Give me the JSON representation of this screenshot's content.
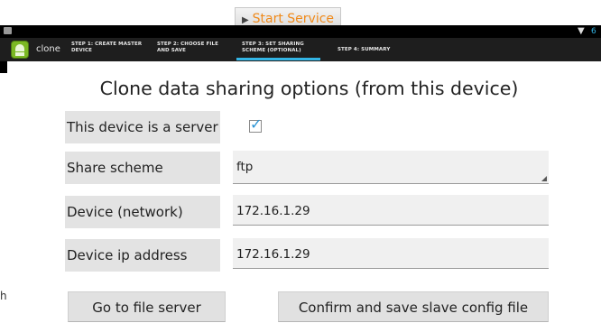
{
  "toolbar": {
    "start_service_label": "Start Service"
  },
  "app": {
    "name": "clone"
  },
  "steps": [
    {
      "label": "STEP 1: CREATE MASTER DEVICE",
      "active": false
    },
    {
      "label": "STEP 2: CHOOSE FILE AND SAVE",
      "active": false
    },
    {
      "label": "STEP 3: SET SHARING SCHEME (OPTIONAL)",
      "active": true
    },
    {
      "label": "STEP 4: SUMMARY",
      "active": false
    }
  ],
  "page": {
    "title": "Clone data sharing options (from this device)"
  },
  "form": {
    "server": {
      "label": "This device is a server",
      "checked": true
    },
    "scheme": {
      "label": "Share scheme",
      "value": "ftp"
    },
    "name": {
      "label": "Device (network) name",
      "value": "172.16.1.29"
    },
    "ip": {
      "label": "Device ip address",
      "value": "172.16.1.29"
    }
  },
  "buttons": {
    "file_server": "Go to file server",
    "confirm": "Confirm and save slave config file"
  },
  "edge_text": "h",
  "colors": {
    "accent": "#33b5e5",
    "start_service": "#f08a1a",
    "checkbox": "#2a93d5"
  }
}
